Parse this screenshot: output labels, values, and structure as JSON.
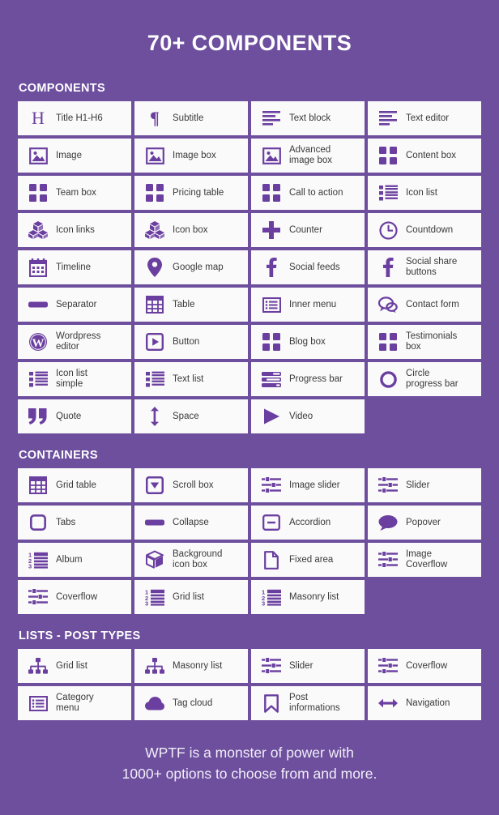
{
  "theme": {
    "background": "#6d4f9e",
    "card_background": "#fafafa",
    "icon_color": "#6b3fa0",
    "label_color": "#3a3a3a",
    "heading_color": "#ffffff"
  },
  "hero": {
    "title": "70+ COMPONENTS"
  },
  "sections": [
    {
      "title": "COMPONENTS",
      "items": [
        {
          "label": "Title H1-H6",
          "icon": "heading-h-icon"
        },
        {
          "label": "Subtitle",
          "icon": "pilcrow-icon"
        },
        {
          "label": "Text block",
          "icon": "text-lines-icon"
        },
        {
          "label": "Text editor",
          "icon": "text-lines-icon"
        },
        {
          "label": "Image",
          "icon": "image-icon"
        },
        {
          "label": "Image box",
          "icon": "image-icon"
        },
        {
          "label": "Advanced\nimage box",
          "icon": "image-icon"
        },
        {
          "label": "Content box",
          "icon": "four-squares-icon"
        },
        {
          "label": "Team box",
          "icon": "four-squares-icon"
        },
        {
          "label": "Pricing table",
          "icon": "four-squares-icon"
        },
        {
          "label": "Call to action",
          "icon": "four-squares-icon"
        },
        {
          "label": "Icon list",
          "icon": "bullet-list-icon"
        },
        {
          "label": "Icon links",
          "icon": "cubes-icon"
        },
        {
          "label": "Icon box",
          "icon": "cubes-icon"
        },
        {
          "label": "Counter",
          "icon": "plus-icon"
        },
        {
          "label": "Countdown",
          "icon": "clock-icon"
        },
        {
          "label": "Timeline",
          "icon": "calendar-icon"
        },
        {
          "label": "Google map",
          "icon": "map-pin-icon"
        },
        {
          "label": "Social feeds",
          "icon": "facebook-icon"
        },
        {
          "label": "Social share\nbuttons",
          "icon": "facebook-icon"
        },
        {
          "label": "Separator",
          "icon": "dash-bar-icon"
        },
        {
          "label": "Table",
          "icon": "table-grid-icon"
        },
        {
          "label": "Inner menu",
          "icon": "inner-menu-icon"
        },
        {
          "label": "Contact form",
          "icon": "chat-bubbles-icon"
        },
        {
          "label": "Wordpress\neditor",
          "icon": "wordpress-icon"
        },
        {
          "label": "Button",
          "icon": "play-square-icon"
        },
        {
          "label": "Blog box",
          "icon": "four-squares-icon"
        },
        {
          "label": "Testimonials\nbox",
          "icon": "four-squares-icon"
        },
        {
          "label": "Icon list\nsimple",
          "icon": "bullet-list-icon"
        },
        {
          "label": "Text list",
          "icon": "bullet-list-icon"
        },
        {
          "label": "Progress bar",
          "icon": "progress-bar-icon"
        },
        {
          "label": "Circle\nprogress bar",
          "icon": "circle-ring-icon"
        },
        {
          "label": "Quote",
          "icon": "quote-icon"
        },
        {
          "label": "Space",
          "icon": "vertical-arrows-icon"
        },
        {
          "label": "Video",
          "icon": "play-triangle-icon"
        }
      ]
    },
    {
      "title": "CONTAINERS",
      "items": [
        {
          "label": "Grid table",
          "icon": "table-grid-icon"
        },
        {
          "label": "Scroll box",
          "icon": "chevron-down-square-icon"
        },
        {
          "label": "Image slider",
          "icon": "sliders-icon"
        },
        {
          "label": "Slider",
          "icon": "sliders-icon"
        },
        {
          "label": "Tabs",
          "icon": "rounded-square-icon"
        },
        {
          "label": "Collapse",
          "icon": "dash-bar-icon"
        },
        {
          "label": "Accordion",
          "icon": "minus-square-icon"
        },
        {
          "label": "Popover",
          "icon": "speech-bubble-icon"
        },
        {
          "label": "Album",
          "icon": "numbered-list-icon"
        },
        {
          "label": "Background\nicon box",
          "icon": "cube-icon"
        },
        {
          "label": "Fixed area",
          "icon": "page-icon"
        },
        {
          "label": "Image\nCoverflow",
          "icon": "sliders-icon"
        },
        {
          "label": "Coverflow",
          "icon": "sliders-icon"
        },
        {
          "label": "Grid list",
          "icon": "numbered-list-icon"
        },
        {
          "label": "Masonry list",
          "icon": "numbered-list-icon"
        }
      ]
    },
    {
      "title": "LISTS - POST TYPES",
      "items": [
        {
          "label": "Grid list",
          "icon": "sitemap-icon"
        },
        {
          "label": "Masonry list",
          "icon": "sitemap-icon"
        },
        {
          "label": "Slider",
          "icon": "sliders-icon"
        },
        {
          "label": "Coverflow",
          "icon": "sliders-icon"
        },
        {
          "label": "Category\nmenu",
          "icon": "inner-menu-icon"
        },
        {
          "label": "Tag cloud",
          "icon": "cloud-icon"
        },
        {
          "label": "Post\ninformations",
          "icon": "bookmark-icon"
        },
        {
          "label": "Navigation",
          "icon": "left-right-arrow-icon"
        }
      ]
    }
  ],
  "footer": {
    "text": "WPTF is a monster of power with\n1000+ options to choose from and more."
  }
}
